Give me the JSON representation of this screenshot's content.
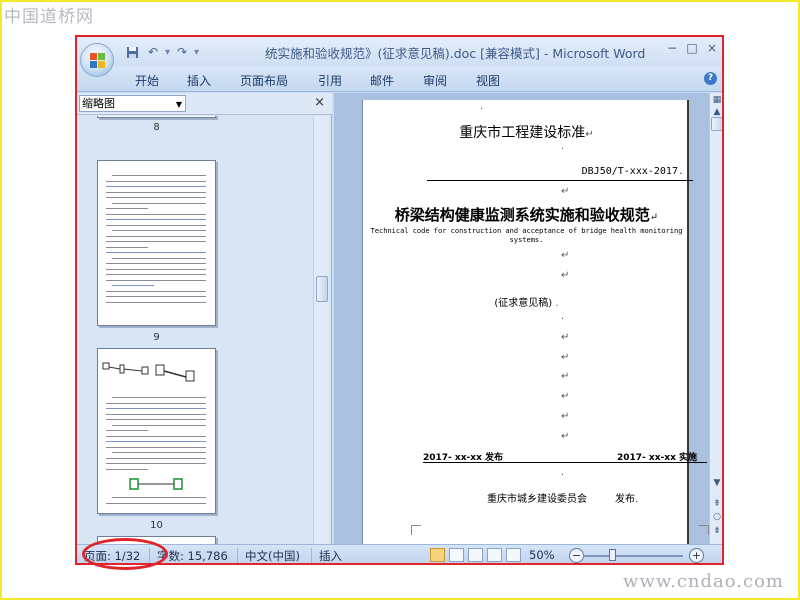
{
  "watermark": {
    "site_name": "中国道桥网",
    "site_url": "www.cndao.com"
  },
  "window": {
    "title": "统实施和验收规范》(征求意见稿).doc [兼容模式]  -  Microsoft Word",
    "controls": {
      "minimize": "−",
      "maximize": "□",
      "close": "×"
    }
  },
  "ribbon": {
    "tabs": [
      "开始",
      "插入",
      "页面布局",
      "引用",
      "邮件",
      "审阅",
      "视图"
    ]
  },
  "nav_pane": {
    "view_select": "缩略图",
    "close": "×",
    "thumbnails": [
      {
        "label": "8"
      },
      {
        "label": "9"
      },
      {
        "label": "10"
      }
    ]
  },
  "document": {
    "header_title": "重庆市工程建设标准",
    "code": "DBJ50/T-xxx-2017",
    "title": "桥梁结构健康监测系统实施和验收规范",
    "subtitle_en_line1": "Technical code for construction and acceptance of bridge health monitoring",
    "subtitle_en_line2": "systems.",
    "draft_label": "(征求意见稿)",
    "issue_date": "2017- xx-xx 发布",
    "effective_date": "2017- xx-xx 实施",
    "issuer": "重庆市城乡建设委员会",
    "issuer_action": "发布"
  },
  "status_bar": {
    "page": "页面: 1/32",
    "word_count": "字数: 15,786",
    "language": "中文(中国)",
    "insert_mode": "插入",
    "zoom": "50%"
  },
  "colors": {
    "window_border": "#e0242b",
    "outer_border": "#f3ea2f",
    "ribbon_bg": "#c9dbf0"
  }
}
